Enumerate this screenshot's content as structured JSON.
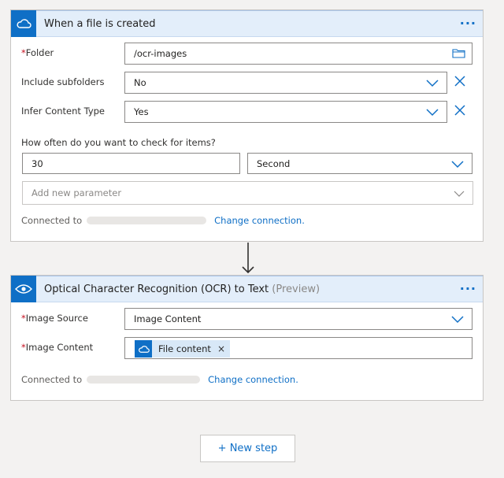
{
  "trigger": {
    "title": "When a file is created",
    "more": "···",
    "folder": {
      "label": "Folder",
      "value": "/ocr-images"
    },
    "include_subfolders": {
      "label": "Include subfolders",
      "value": "No"
    },
    "infer_content_type": {
      "label": "Infer Content Type",
      "value": "Yes"
    },
    "frequency_question": "How often do you want to check for items?",
    "interval_value": "30",
    "frequency_value": "Second",
    "add_parameter_placeholder": "Add new parameter",
    "connected_to": "Connected to",
    "change_connection": "Change connection."
  },
  "action": {
    "title": "Optical Character Recognition (OCR) to Text",
    "preview": "(Preview)",
    "more": "···",
    "image_source": {
      "label": "Image Source",
      "value": "Image Content"
    },
    "image_content": {
      "label": "Image Content",
      "token": "File content",
      "token_remove": "×"
    },
    "connected_to": "Connected to",
    "change_connection": "Change connection."
  },
  "new_step_label": "+ New step",
  "colors": {
    "accent": "#0f6fc6",
    "header_bg": "#e3eefa",
    "required": "#c50f1f"
  },
  "icons": [
    "onedrive-cloud-icon",
    "eye-icon",
    "folder-icon",
    "chevron-down-icon",
    "close-icon",
    "arrow-down-icon"
  ]
}
